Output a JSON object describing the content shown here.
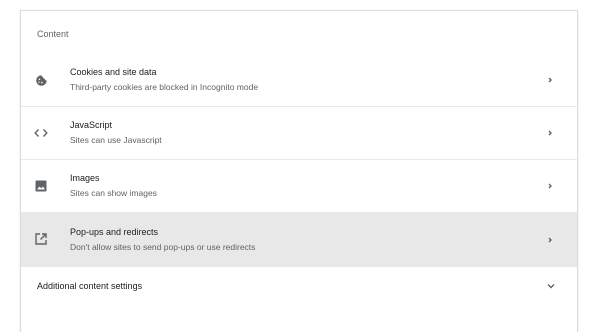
{
  "section": {
    "title": "Content"
  },
  "rows": [
    {
      "title": "Cookies and site data",
      "subtitle": "Third-party cookies are blocked in Incognito mode",
      "icon": "cookie-icon"
    },
    {
      "title": "JavaScript",
      "subtitle": "Sites can use Javascript",
      "icon": "code-icon"
    },
    {
      "title": "Images",
      "subtitle": "Sites can show images",
      "icon": "image-icon"
    },
    {
      "title": "Pop-ups and redirects",
      "subtitle": "Don't allow sites to send pop-ups or use redirects",
      "icon": "open-in-new-icon"
    }
  ],
  "additional": {
    "label": "Additional content settings",
    "icon": "chevron-down-icon"
  },
  "colors": {
    "highlight": "#e8e8e8",
    "icon": "#5f6368",
    "text": "#202124",
    "secondary": "#5f6368"
  }
}
